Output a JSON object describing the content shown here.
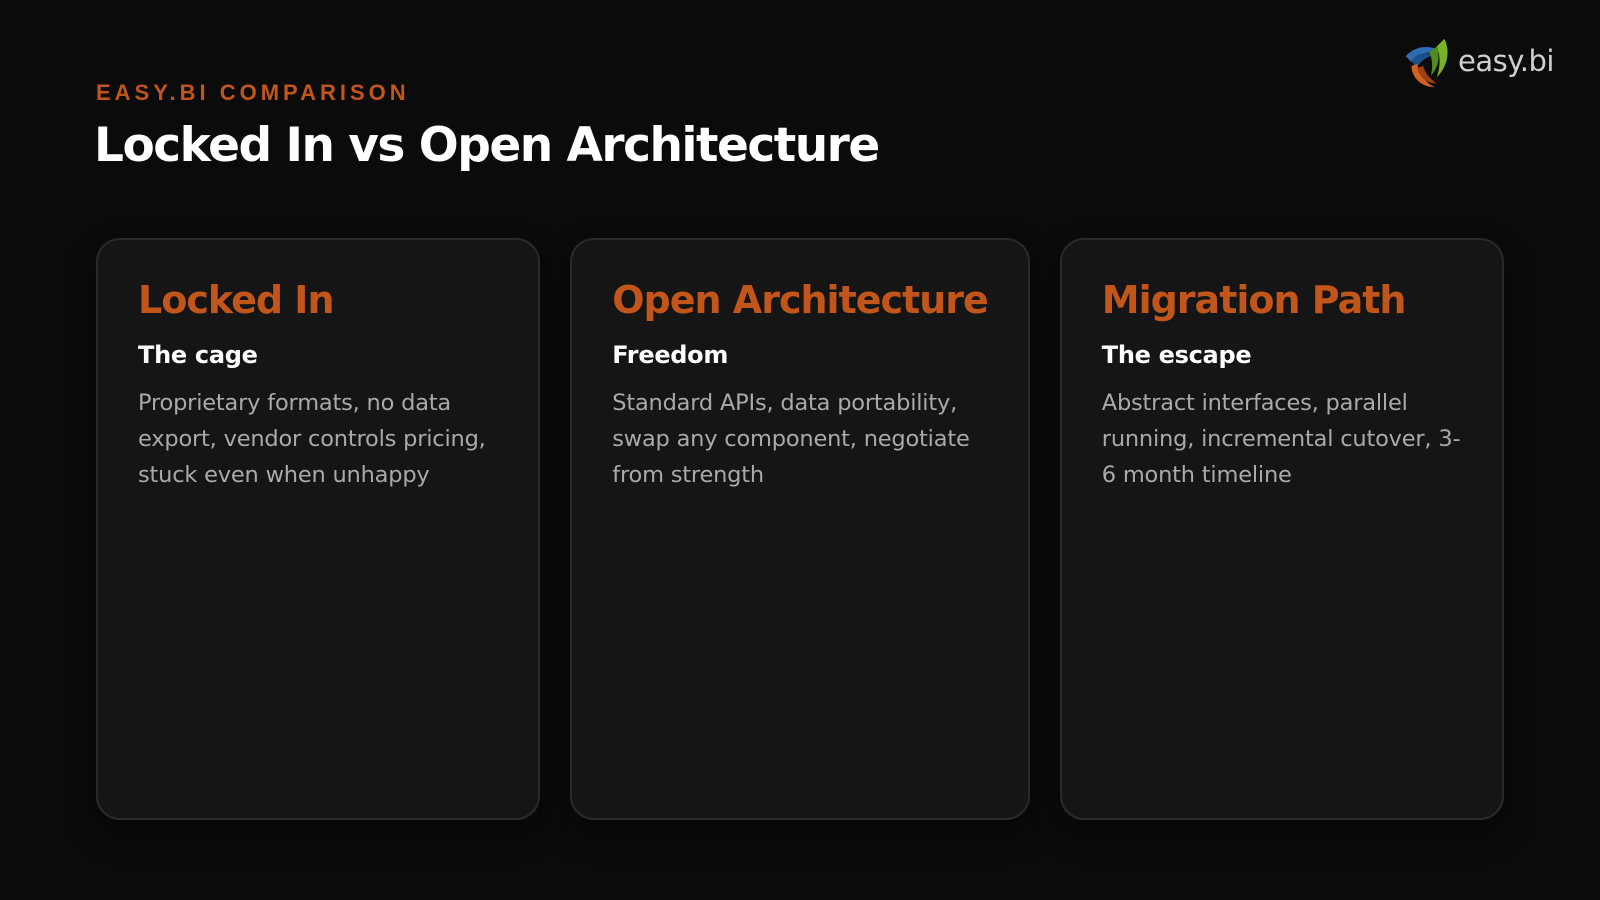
{
  "brand": {
    "logo_text": "easy.bi",
    "logo_icon": "easybi-swirl-logo",
    "accent_color": "#c2561a"
  },
  "header": {
    "eyebrow": "EASY.BI COMPARISON",
    "title": "Locked In vs Open Architecture"
  },
  "cards": [
    {
      "title": "Locked In",
      "subtitle": "The cage",
      "body": "Proprietary formats, no data export, vendor controls pricing, stuck even when unhappy"
    },
    {
      "title": "Open Architecture",
      "subtitle": "Freedom",
      "body": "Standard APIs, data portability, swap any component, negotiate from strength"
    },
    {
      "title": "Migration Path",
      "subtitle": "The escape",
      "body": "Abstract interfaces, parallel running, incremental cutover, 3-6 month timeline"
    }
  ],
  "colors": {
    "background": "#0b0b0b",
    "card_background": "#151515",
    "card_border": "#2a2a2a",
    "body_text": "#a9a9a9"
  }
}
